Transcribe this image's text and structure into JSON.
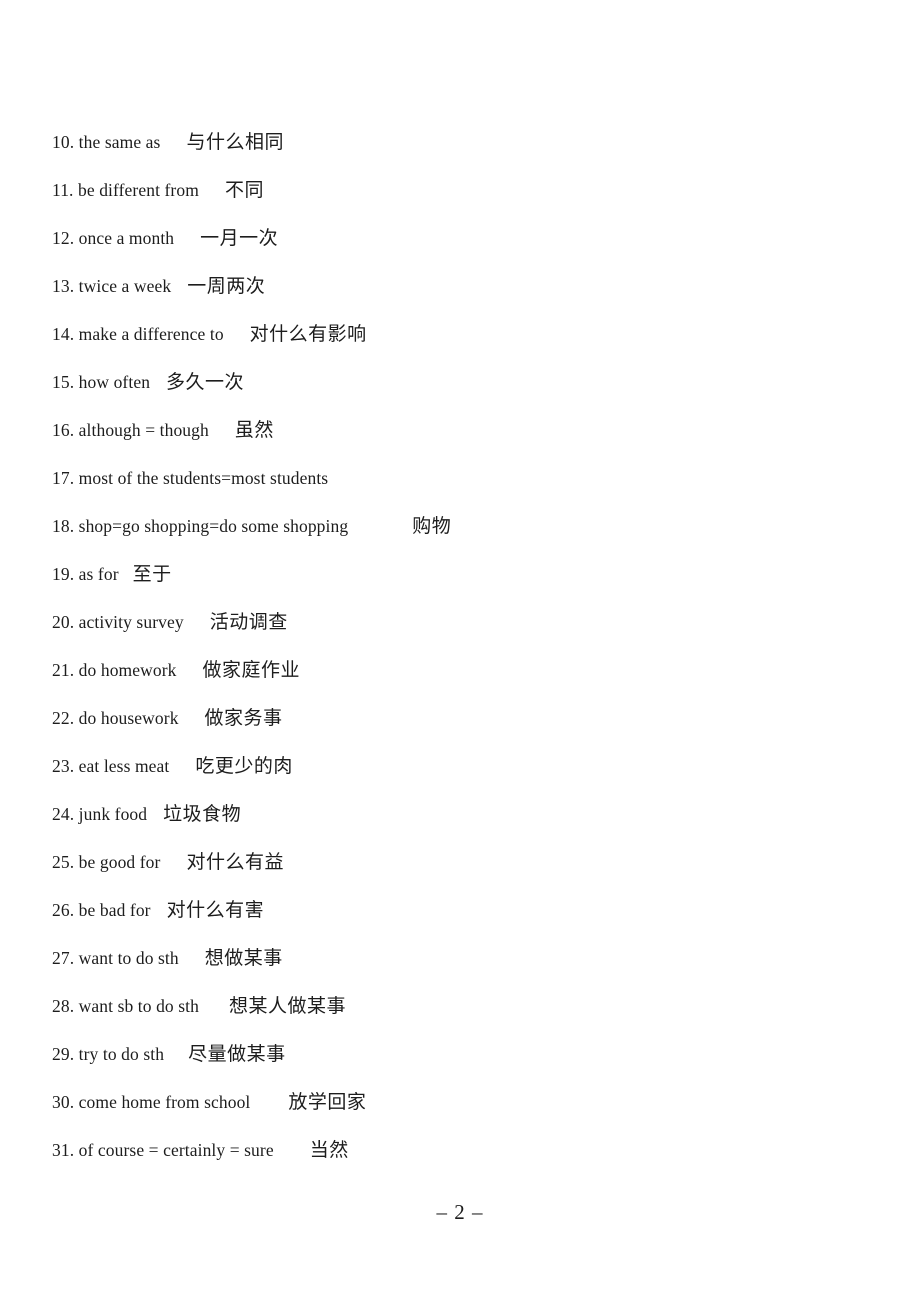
{
  "document": {
    "page_footer": "– 2 –",
    "text_color": "#1d1d1d",
    "background_color": "#ffffff"
  },
  "vocab_list": {
    "items": [
      {
        "number": "10.",
        "english": "the same as",
        "gap": 26,
        "chinese": "与什么相同"
      },
      {
        "number": "11.",
        "english": "be different from",
        "gap": 26,
        "chinese": "不同"
      },
      {
        "number": "12.",
        "english": "once a month",
        "gap": 26,
        "chinese": "一月一次"
      },
      {
        "number": "13.",
        "english": "twice a week",
        "gap": 16,
        "chinese": "一周两次"
      },
      {
        "number": "14.",
        "english": "make a difference to",
        "gap": 26,
        "chinese": "对什么有影响"
      },
      {
        "number": "15.",
        "english": "how often",
        "gap": 16,
        "chinese": "多久一次"
      },
      {
        "number": "16.",
        "english": "although = though",
        "gap": 26,
        "chinese": "虽然"
      },
      {
        "number": "17.",
        "english": "most of the students=most students",
        "gap": 0,
        "chinese": ""
      },
      {
        "number": "18.",
        "english": "shop=go shopping=do some shopping",
        "gap": 64,
        "chinese": "购物"
      },
      {
        "number": "19.",
        "english": "as for",
        "gap": 14,
        "chinese": "至于"
      },
      {
        "number": "20.",
        "english": "activity survey",
        "gap": 26,
        "chinese": "活动调查"
      },
      {
        "number": "21.",
        "english": "do homework",
        "gap": 26,
        "chinese": "做家庭作业"
      },
      {
        "number": "22.",
        "english": "do housework",
        "gap": 26,
        "chinese": "做家务事"
      },
      {
        "number": "23.",
        "english": "eat less meat",
        "gap": 26,
        "chinese": "吃更少的肉"
      },
      {
        "number": "24.",
        "english": "junk food",
        "gap": 16,
        "chinese": "垃圾食物"
      },
      {
        "number": "25.",
        "english": "be good for",
        "gap": 26,
        "chinese": "对什么有益"
      },
      {
        "number": "26.",
        "english": "be bad for",
        "gap": 16,
        "chinese": "对什么有害"
      },
      {
        "number": "27.",
        "english": "want to do sth",
        "gap": 26,
        "chinese": "想做某事"
      },
      {
        "number": "28.",
        "english": "want sb to do sth",
        "gap": 30,
        "chinese": "想某人做某事"
      },
      {
        "number": "29.",
        "english": "try to do sth",
        "gap": 24,
        "chinese": "尽量做某事"
      },
      {
        "number": "30.",
        "english": "come home from school",
        "gap": 38,
        "chinese": "放学回家"
      },
      {
        "number": "31.",
        "english": "of course = certainly = sure",
        "gap": 36,
        "chinese": "当然"
      }
    ]
  }
}
